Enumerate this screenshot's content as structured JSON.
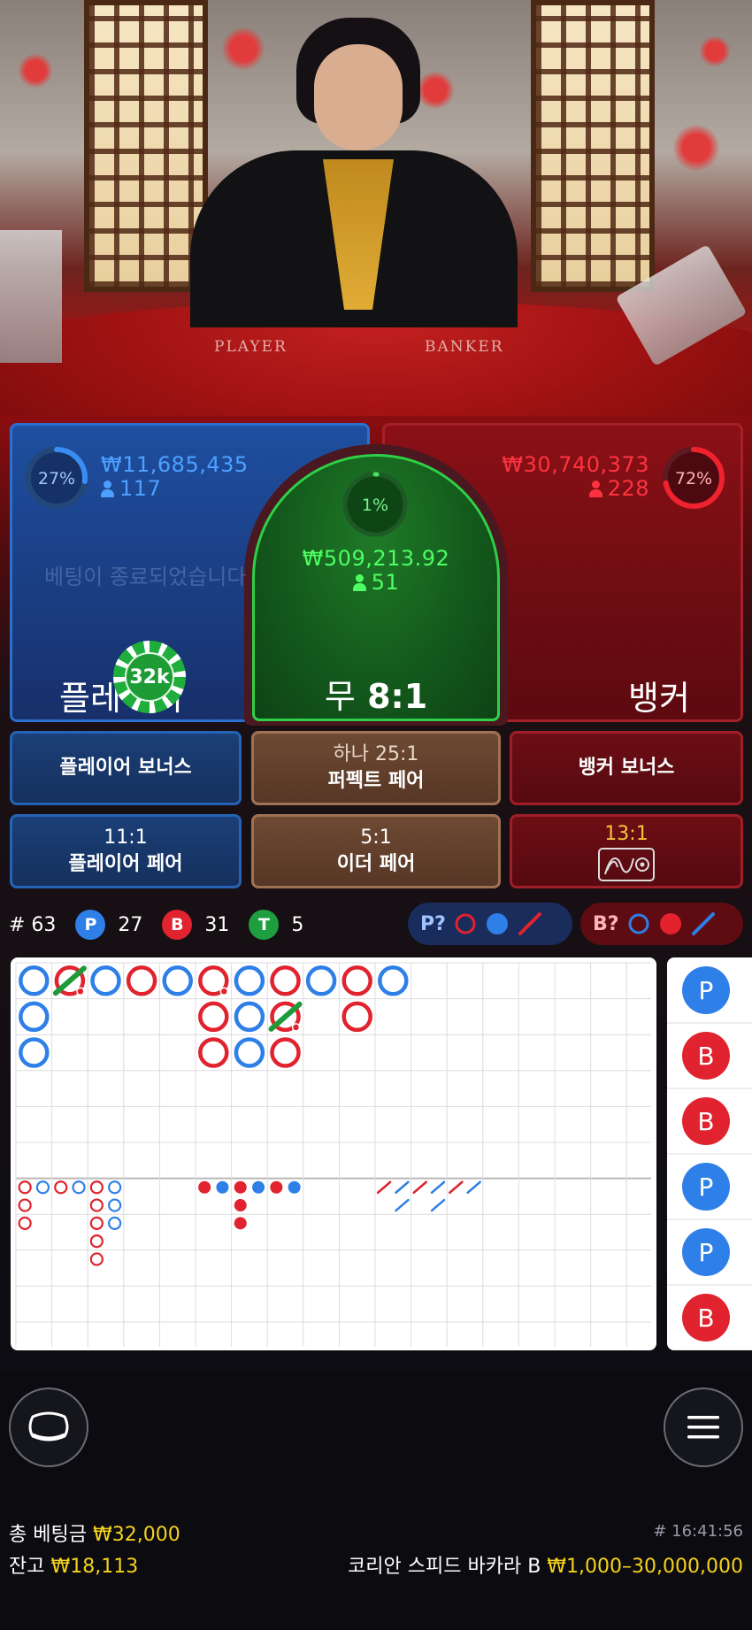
{
  "video": {
    "table_label_player": "PLAYER",
    "table_label_banker": "BANKER"
  },
  "colors": {
    "player": "#2b70cf",
    "banker": "#d9232d",
    "tie": "#2fcf47",
    "highlight": "#f6d21c"
  },
  "player": {
    "percent": "27%",
    "percent_value": 27,
    "amount": "₩11,685,435",
    "players": "117",
    "label": "플레이어",
    "closed_message": "베팅이 종료되었습니다",
    "chip": "32k"
  },
  "tie": {
    "percent": "1%",
    "percent_value": 1,
    "amount": "₩509,213.92",
    "players": "51",
    "label": "무",
    "odds": "8:1"
  },
  "banker": {
    "percent": "72%",
    "percent_value": 72,
    "amount": "₩30,740,373",
    "players": "228",
    "label": "뱅커"
  },
  "side_bets": {
    "player_bonus": "플레이어 보너스",
    "perfect_pair_odds": "하나 25:1",
    "perfect_pair": "퍼펙트 페어",
    "banker_bonus": "뱅커 보너스",
    "player_pair_odds": "11:1",
    "player_pair": "플레이어 페어",
    "either_pair_odds": "5:1",
    "either_pair": "이더 페어",
    "super_odds": "13:1",
    "super_icon": "dragon-icon"
  },
  "stats": {
    "round": "# 63",
    "p_letter": "P",
    "p_count": "27",
    "b_letter": "B",
    "b_count": "31",
    "t_letter": "T",
    "t_count": "5",
    "p_predict": "P?",
    "b_predict": "B?"
  },
  "roadmaps": {
    "big_road": [
      {
        "col": 0,
        "row": 0,
        "c": "P"
      },
      {
        "col": 0,
        "row": 1,
        "c": "P"
      },
      {
        "col": 0,
        "row": 2,
        "c": "P"
      },
      {
        "col": 1,
        "row": 0,
        "c": "B",
        "tie": true,
        "pair": true
      },
      {
        "col": 2,
        "row": 0,
        "c": "P"
      },
      {
        "col": 3,
        "row": 0,
        "c": "B"
      },
      {
        "col": 4,
        "row": 0,
        "c": "P"
      },
      {
        "col": 5,
        "row": 0,
        "c": "B",
        "pair": true
      },
      {
        "col": 5,
        "row": 1,
        "c": "B"
      },
      {
        "col": 5,
        "row": 2,
        "c": "B"
      },
      {
        "col": 6,
        "row": 0,
        "c": "P"
      },
      {
        "col": 6,
        "row": 1,
        "c": "P"
      },
      {
        "col": 6,
        "row": 2,
        "c": "P"
      },
      {
        "col": 7,
        "row": 0,
        "c": "B"
      },
      {
        "col": 7,
        "row": 1,
        "c": "B",
        "tie": true,
        "pair": true
      },
      {
        "col": 7,
        "row": 2,
        "c": "B"
      },
      {
        "col": 8,
        "row": 0,
        "c": "P"
      },
      {
        "col": 9,
        "row": 0,
        "c": "B"
      },
      {
        "col": 9,
        "row": 1,
        "c": "B"
      },
      {
        "col": 10,
        "row": 0,
        "c": "P"
      }
    ],
    "big_eye": [
      {
        "col": 0,
        "row": 0,
        "c": "B"
      },
      {
        "col": 0,
        "row": 1,
        "c": "B"
      },
      {
        "col": 0,
        "row": 2,
        "c": "B"
      },
      {
        "col": 1,
        "row": 0,
        "c": "P"
      },
      {
        "col": 2,
        "row": 0,
        "c": "B"
      },
      {
        "col": 3,
        "row": 0,
        "c": "P"
      },
      {
        "col": 4,
        "row": 0,
        "c": "B"
      },
      {
        "col": 4,
        "row": 1,
        "c": "B"
      },
      {
        "col": 4,
        "row": 2,
        "c": "B"
      },
      {
        "col": 4,
        "row": 3,
        "c": "B"
      },
      {
        "col": 4,
        "row": 4,
        "c": "B"
      },
      {
        "col": 5,
        "row": 0,
        "c": "P"
      },
      {
        "col": 5,
        "row": 1,
        "c": "P"
      },
      {
        "col": 5,
        "row": 2,
        "c": "P"
      }
    ],
    "small_road": [
      {
        "col": 0,
        "row": 0,
        "c": "B"
      },
      {
        "col": 1,
        "row": 0,
        "c": "P"
      },
      {
        "col": 2,
        "row": 0,
        "c": "B"
      },
      {
        "col": 2,
        "row": 1,
        "c": "B"
      },
      {
        "col": 2,
        "row": 2,
        "c": "B"
      },
      {
        "col": 3,
        "row": 0,
        "c": "P"
      },
      {
        "col": 4,
        "row": 0,
        "c": "B"
      },
      {
        "col": 5,
        "row": 0,
        "c": "P"
      }
    ],
    "cockroach": [
      {
        "col": 0,
        "row": 0,
        "c": "B"
      },
      {
        "col": 1,
        "row": 0,
        "c": "P"
      },
      {
        "col": 1,
        "row": 1,
        "c": "P"
      },
      {
        "col": 2,
        "row": 0,
        "c": "B"
      },
      {
        "col": 3,
        "row": 0,
        "c": "P"
      },
      {
        "col": 3,
        "row": 1,
        "c": "P"
      },
      {
        "col": 4,
        "row": 0,
        "c": "B"
      },
      {
        "col": 5,
        "row": 0,
        "c": "P"
      }
    ],
    "bead_side": [
      "P",
      "B",
      "B",
      "P",
      "P",
      "B"
    ]
  },
  "buttons": {
    "lobby_icon": "lobby-icon",
    "menu_icon": "hamburger-menu-icon"
  },
  "footer": {
    "total_bet_label": "총 베팅금",
    "total_bet_value": "₩32,000",
    "balance_label": "잔고",
    "balance_value": "₩18,113",
    "round_time": "# 16:41:56",
    "table_name": "코리안 스피드 바카라 B",
    "limits": "₩1,000–30,000,000"
  }
}
